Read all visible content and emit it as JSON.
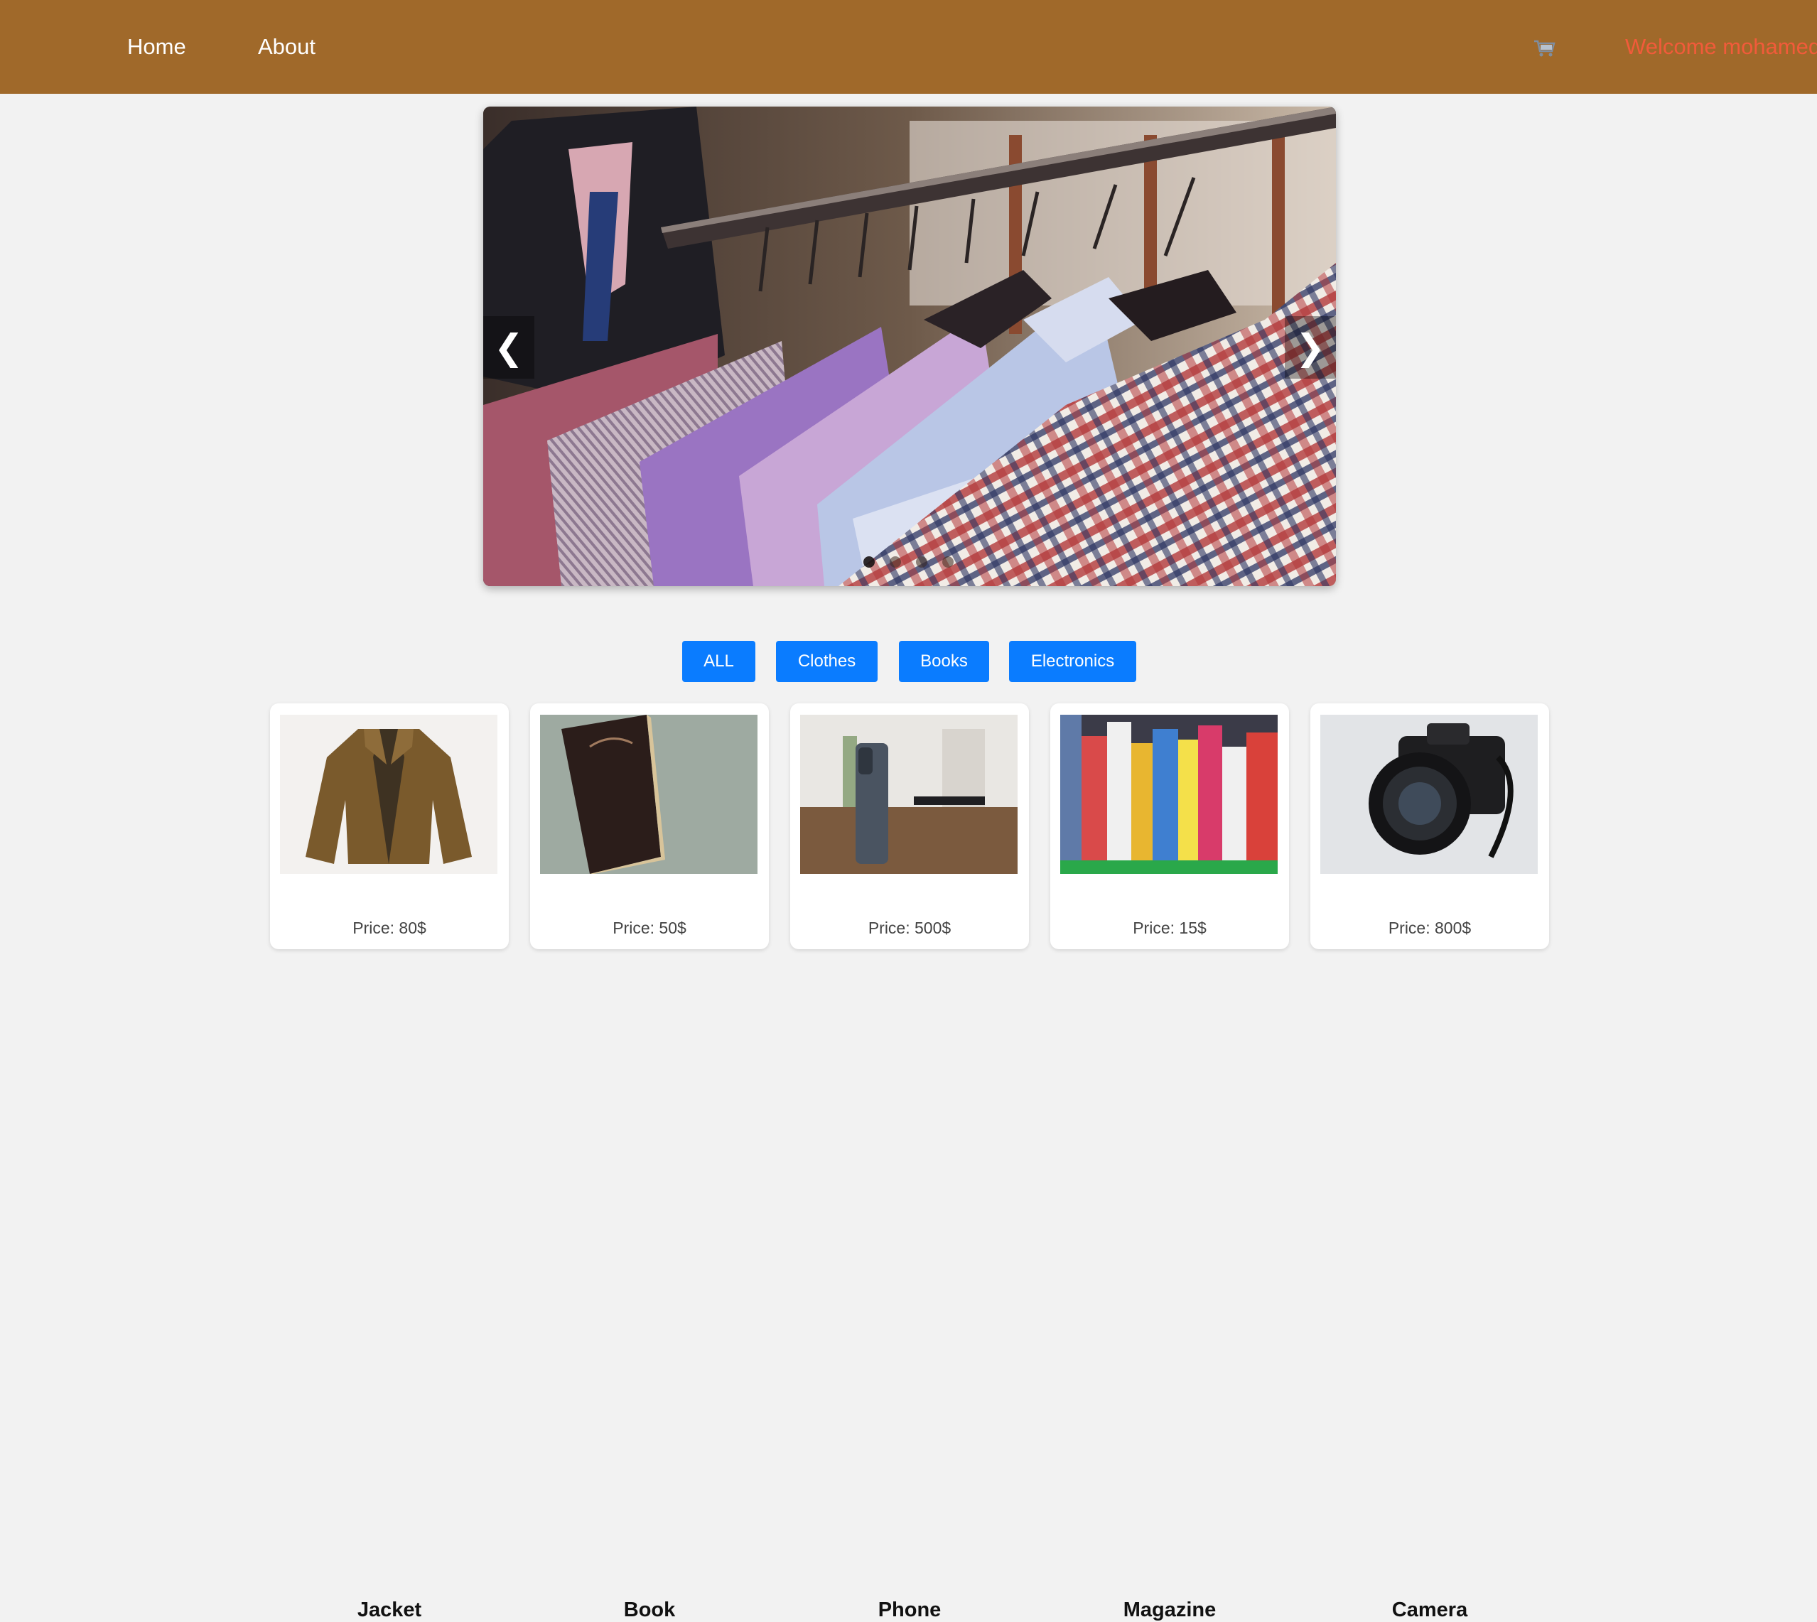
{
  "nav": {
    "links": [
      "Home",
      "About"
    ],
    "cart_icon": "cart-icon",
    "welcome_text": "Welcome mohamed"
  },
  "colors": {
    "navbar": "#a0692a",
    "welcome": "#f15b3a",
    "filter_button": "#0a7cff",
    "page_background": "#f2f2f2"
  },
  "carousel": {
    "prev_icon": "chevron-left-icon",
    "next_icon": "chevron-right-icon",
    "prev_glyph": "❮",
    "next_glyph": "❯",
    "slide_count": 4,
    "active_slide": 1
  },
  "filters": [
    "ALL",
    "Clothes",
    "Books",
    "Electronics"
  ],
  "products": [
    {
      "name": "Jacket",
      "price": "Price: 80$"
    },
    {
      "name": "Book",
      "price": "Price: 50$"
    },
    {
      "name": "Phone",
      "price": "Price: 500$"
    },
    {
      "name": "Magazine",
      "price": "Price: 15$"
    },
    {
      "name": "Camera",
      "price": "Price: 800$"
    }
  ]
}
